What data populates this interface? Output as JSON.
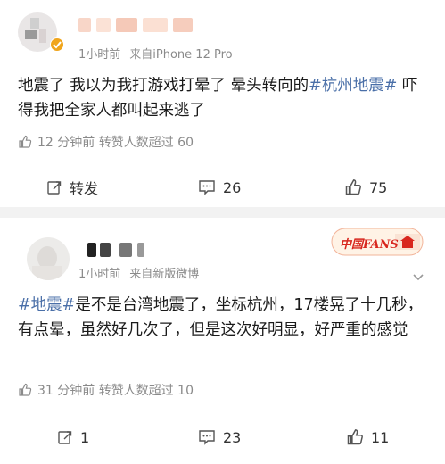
{
  "posts": [
    {
      "meta": {
        "time": "1小时前",
        "source": "来自iPhone 12 Pro"
      },
      "content": [
        {
          "text": "地震了 我以为我打游戏打晕了 晕头转向的",
          "hashtag": false
        },
        {
          "text": "#杭州地震#",
          "hashtag": true
        },
        {
          "text": " 吓得我把全家人都叫起来逃了",
          "hashtag": false
        }
      ],
      "stat_text": "12 分钟前  转赞人数超过 60",
      "actions": {
        "repost": "转发",
        "comments": "26",
        "likes": "75"
      }
    },
    {
      "meta": {
        "time": "1小时前",
        "source": "来自新版微博"
      },
      "content": [
        {
          "text": "#地震#",
          "hashtag": true
        },
        {
          "text": "是不是台湾地震了，坐标杭州，17楼晃了十几秒，有点晕，虽然好几次了，但是这次好明显，好严重的感觉",
          "hashtag": false
        }
      ],
      "stat_text": "31 分钟前  转赞人数超过 10",
      "actions": {
        "repost": "1",
        "comments": "23",
        "likes": "11"
      },
      "badge": "中国FANS"
    }
  ],
  "colors": {
    "hashtag": "#4a6fa8",
    "meta": "#8a8a8a",
    "badge": "#d8261e"
  },
  "icons": [
    "verified-icon",
    "thumb-up-icon",
    "repost-icon",
    "comment-icon",
    "more-icon"
  ]
}
